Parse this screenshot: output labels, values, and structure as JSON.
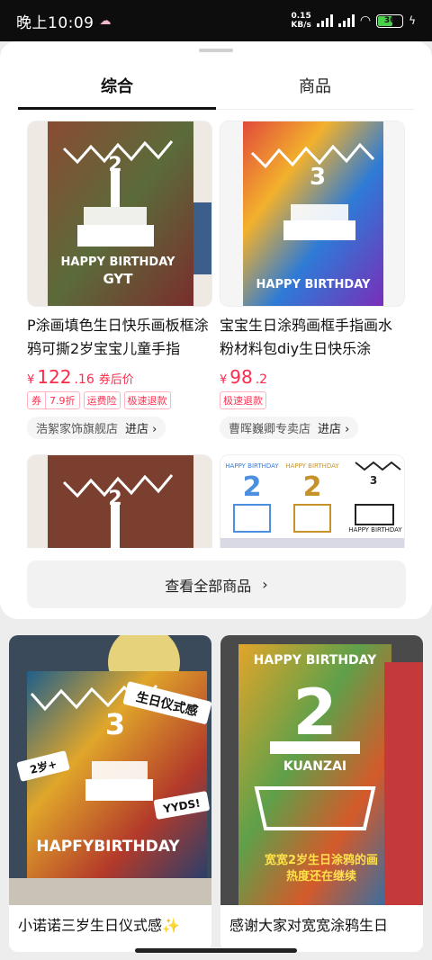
{
  "status": {
    "time": "晚上10:09",
    "speed_value": "0.15",
    "speed_unit": "KB/s",
    "battery": "36"
  },
  "tabs": [
    {
      "label": "综合",
      "active": true
    },
    {
      "label": "商品",
      "active": false
    }
  ],
  "products": [
    {
      "title": "P涂画填色生日快乐画板框涂鸦可撕2岁宝宝儿童手指",
      "price_currency": "¥",
      "price_int": "122",
      "price_dec": ".16",
      "price_note": "券后价",
      "coupon_label": "券",
      "coupon_value": "7.9折",
      "tag_shipping": "运费险",
      "tag_refund": "极速退款",
      "shop": "浩絮家饰旗舰店",
      "enter": "进店",
      "image_text": "HAPPY BIRTHDAY GYT",
      "image_number": "2"
    },
    {
      "title": "宝宝生日涂鸦画框手指画水粉材料包diy生日快乐涂",
      "price_currency": "¥",
      "price_int": "98",
      "price_dec": ".2",
      "tag_refund": "极速退款",
      "shop": "曹晖巍卿专卖店",
      "enter": "进店",
      "image_text": "HAPPY BIRTHDAY",
      "image_number": "3"
    }
  ],
  "row2": [
    {
      "image_number": "2"
    },
    {
      "image_texts": [
        "HAPPY BIRTHDAY",
        "HAPPY BIRTHDAY",
        "HAPPY BIRTHDAY"
      ],
      "numbers": [
        "2",
        "2",
        "3"
      ]
    }
  ],
  "view_all": "查看全部商品",
  "feed": [
    {
      "title": "小诺诺三岁生日仪式感✨",
      "stickers": [
        "生日仪式感",
        "2岁+",
        "YYDS!"
      ],
      "image_text": "HAPFYBIRTHDAY",
      "image_number": "3"
    },
    {
      "title": "感谢大家对宽宽涂鸦生日",
      "image_top_text": "HAPPY BIRTHDAY",
      "image_name": "KUANZAI",
      "image_number": "2",
      "caption_line1": "宽宽2岁生日涂鸦的画",
      "caption_line2": "热度还在继续"
    }
  ],
  "colors": {
    "price": "#ff2a4a",
    "accent_tab": "#111111"
  }
}
